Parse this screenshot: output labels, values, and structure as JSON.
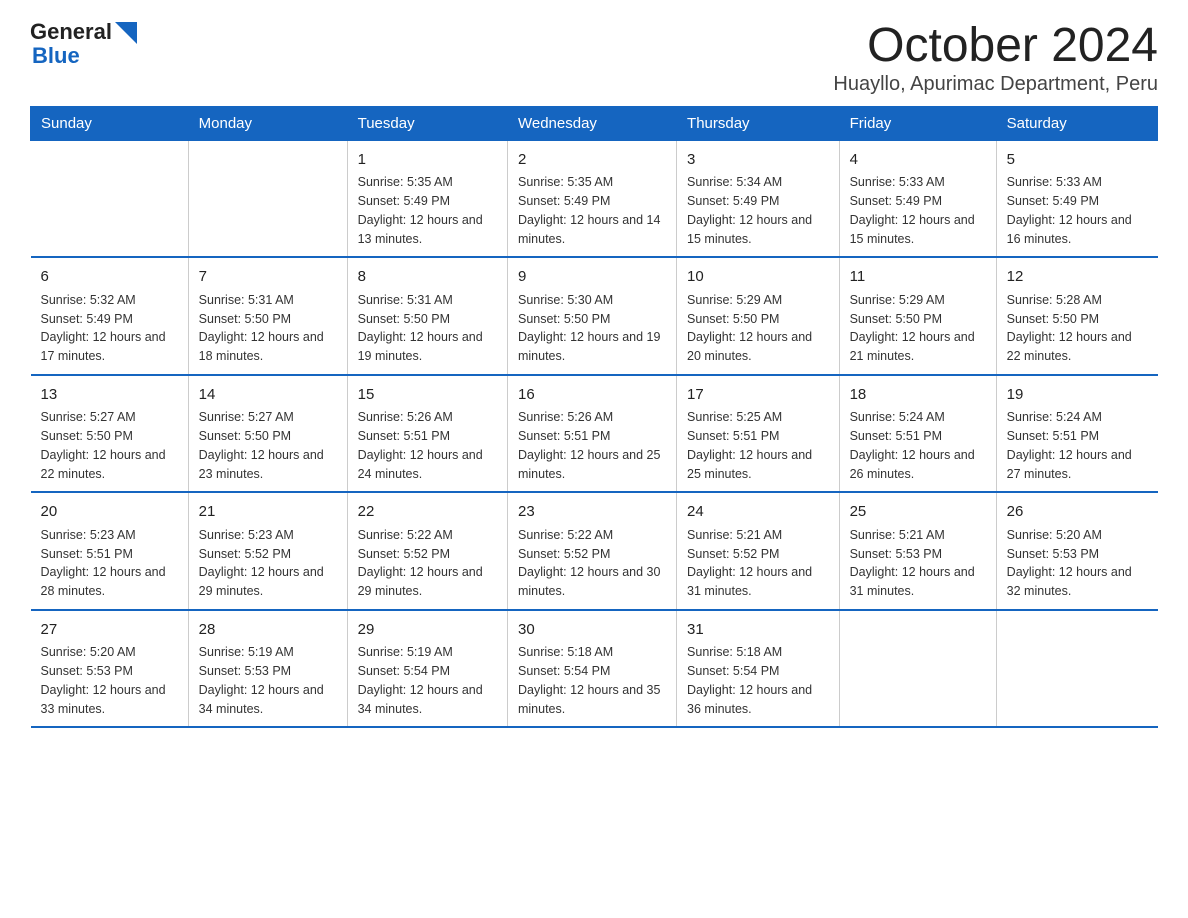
{
  "logo": {
    "text_general": "General",
    "text_blue": "Blue",
    "triangle": "▶"
  },
  "title": "October 2024",
  "subtitle": "Huayllo, Apurimac Department, Peru",
  "headers": [
    "Sunday",
    "Monday",
    "Tuesday",
    "Wednesday",
    "Thursday",
    "Friday",
    "Saturday"
  ],
  "weeks": [
    [
      {
        "day": "",
        "sunrise": "",
        "sunset": "",
        "daylight": ""
      },
      {
        "day": "",
        "sunrise": "",
        "sunset": "",
        "daylight": ""
      },
      {
        "day": "1",
        "sunrise": "Sunrise: 5:35 AM",
        "sunset": "Sunset: 5:49 PM",
        "daylight": "Daylight: 12 hours and 13 minutes."
      },
      {
        "day": "2",
        "sunrise": "Sunrise: 5:35 AM",
        "sunset": "Sunset: 5:49 PM",
        "daylight": "Daylight: 12 hours and 14 minutes."
      },
      {
        "day": "3",
        "sunrise": "Sunrise: 5:34 AM",
        "sunset": "Sunset: 5:49 PM",
        "daylight": "Daylight: 12 hours and 15 minutes."
      },
      {
        "day": "4",
        "sunrise": "Sunrise: 5:33 AM",
        "sunset": "Sunset: 5:49 PM",
        "daylight": "Daylight: 12 hours and 15 minutes."
      },
      {
        "day": "5",
        "sunrise": "Sunrise: 5:33 AM",
        "sunset": "Sunset: 5:49 PM",
        "daylight": "Daylight: 12 hours and 16 minutes."
      }
    ],
    [
      {
        "day": "6",
        "sunrise": "Sunrise: 5:32 AM",
        "sunset": "Sunset: 5:49 PM",
        "daylight": "Daylight: 12 hours and 17 minutes."
      },
      {
        "day": "7",
        "sunrise": "Sunrise: 5:31 AM",
        "sunset": "Sunset: 5:50 PM",
        "daylight": "Daylight: 12 hours and 18 minutes."
      },
      {
        "day": "8",
        "sunrise": "Sunrise: 5:31 AM",
        "sunset": "Sunset: 5:50 PM",
        "daylight": "Daylight: 12 hours and 19 minutes."
      },
      {
        "day": "9",
        "sunrise": "Sunrise: 5:30 AM",
        "sunset": "Sunset: 5:50 PM",
        "daylight": "Daylight: 12 hours and 19 minutes."
      },
      {
        "day": "10",
        "sunrise": "Sunrise: 5:29 AM",
        "sunset": "Sunset: 5:50 PM",
        "daylight": "Daylight: 12 hours and 20 minutes."
      },
      {
        "day": "11",
        "sunrise": "Sunrise: 5:29 AM",
        "sunset": "Sunset: 5:50 PM",
        "daylight": "Daylight: 12 hours and 21 minutes."
      },
      {
        "day": "12",
        "sunrise": "Sunrise: 5:28 AM",
        "sunset": "Sunset: 5:50 PM",
        "daylight": "Daylight: 12 hours and 22 minutes."
      }
    ],
    [
      {
        "day": "13",
        "sunrise": "Sunrise: 5:27 AM",
        "sunset": "Sunset: 5:50 PM",
        "daylight": "Daylight: 12 hours and 22 minutes."
      },
      {
        "day": "14",
        "sunrise": "Sunrise: 5:27 AM",
        "sunset": "Sunset: 5:50 PM",
        "daylight": "Daylight: 12 hours and 23 minutes."
      },
      {
        "day": "15",
        "sunrise": "Sunrise: 5:26 AM",
        "sunset": "Sunset: 5:51 PM",
        "daylight": "Daylight: 12 hours and 24 minutes."
      },
      {
        "day": "16",
        "sunrise": "Sunrise: 5:26 AM",
        "sunset": "Sunset: 5:51 PM",
        "daylight": "Daylight: 12 hours and 25 minutes."
      },
      {
        "day": "17",
        "sunrise": "Sunrise: 5:25 AM",
        "sunset": "Sunset: 5:51 PM",
        "daylight": "Daylight: 12 hours and 25 minutes."
      },
      {
        "day": "18",
        "sunrise": "Sunrise: 5:24 AM",
        "sunset": "Sunset: 5:51 PM",
        "daylight": "Daylight: 12 hours and 26 minutes."
      },
      {
        "day": "19",
        "sunrise": "Sunrise: 5:24 AM",
        "sunset": "Sunset: 5:51 PM",
        "daylight": "Daylight: 12 hours and 27 minutes."
      }
    ],
    [
      {
        "day": "20",
        "sunrise": "Sunrise: 5:23 AM",
        "sunset": "Sunset: 5:51 PM",
        "daylight": "Daylight: 12 hours and 28 minutes."
      },
      {
        "day": "21",
        "sunrise": "Sunrise: 5:23 AM",
        "sunset": "Sunset: 5:52 PM",
        "daylight": "Daylight: 12 hours and 29 minutes."
      },
      {
        "day": "22",
        "sunrise": "Sunrise: 5:22 AM",
        "sunset": "Sunset: 5:52 PM",
        "daylight": "Daylight: 12 hours and 29 minutes."
      },
      {
        "day": "23",
        "sunrise": "Sunrise: 5:22 AM",
        "sunset": "Sunset: 5:52 PM",
        "daylight": "Daylight: 12 hours and 30 minutes."
      },
      {
        "day": "24",
        "sunrise": "Sunrise: 5:21 AM",
        "sunset": "Sunset: 5:52 PM",
        "daylight": "Daylight: 12 hours and 31 minutes."
      },
      {
        "day": "25",
        "sunrise": "Sunrise: 5:21 AM",
        "sunset": "Sunset: 5:53 PM",
        "daylight": "Daylight: 12 hours and 31 minutes."
      },
      {
        "day": "26",
        "sunrise": "Sunrise: 5:20 AM",
        "sunset": "Sunset: 5:53 PM",
        "daylight": "Daylight: 12 hours and 32 minutes."
      }
    ],
    [
      {
        "day": "27",
        "sunrise": "Sunrise: 5:20 AM",
        "sunset": "Sunset: 5:53 PM",
        "daylight": "Daylight: 12 hours and 33 minutes."
      },
      {
        "day": "28",
        "sunrise": "Sunrise: 5:19 AM",
        "sunset": "Sunset: 5:53 PM",
        "daylight": "Daylight: 12 hours and 34 minutes."
      },
      {
        "day": "29",
        "sunrise": "Sunrise: 5:19 AM",
        "sunset": "Sunset: 5:54 PM",
        "daylight": "Daylight: 12 hours and 34 minutes."
      },
      {
        "day": "30",
        "sunrise": "Sunrise: 5:18 AM",
        "sunset": "Sunset: 5:54 PM",
        "daylight": "Daylight: 12 hours and 35 minutes."
      },
      {
        "day": "31",
        "sunrise": "Sunrise: 5:18 AM",
        "sunset": "Sunset: 5:54 PM",
        "daylight": "Daylight: 12 hours and 36 minutes."
      },
      {
        "day": "",
        "sunrise": "",
        "sunset": "",
        "daylight": ""
      },
      {
        "day": "",
        "sunrise": "",
        "sunset": "",
        "daylight": ""
      }
    ]
  ]
}
